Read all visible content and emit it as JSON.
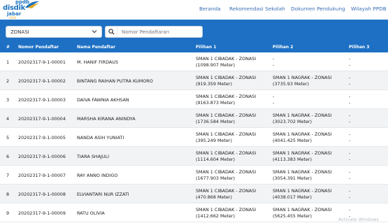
{
  "brand": {
    "line1": "ppdb",
    "line2": "disdik",
    "line3": "jabar",
    "year": "2020",
    "colors": {
      "primary": "#1d70c4",
      "accent": "#e2a820"
    }
  },
  "nav": {
    "items": [
      {
        "label": "Beranda"
      },
      {
        "label": "Rekomendasi Sekolah"
      },
      {
        "label": "Dokumen Pendukung"
      },
      {
        "label": "Wilayah PPDB"
      }
    ]
  },
  "filter": {
    "select_value": "ZONASI",
    "search_placeholder": "Nomor Pendaftaran",
    "select_icon": "chevron-down-icon",
    "search_icon": "search-icon"
  },
  "table": {
    "headers": [
      "#",
      "Nomor Pendaftar",
      "Nama Pendaftar",
      "Pilihan 1",
      "Pilihan 2",
      "Pilihan 3"
    ],
    "rows": [
      {
        "no": "1",
        "nomor": "20202317-9-1-00001",
        "nama": "M. HANIF FIRDAUS",
        "p1": "SMAN 1 CIBADAK - ZONASI",
        "p1d": "(1098.907 Meter)",
        "p2": "-",
        "p2d": "-",
        "p3": "-",
        "p3d": "-"
      },
      {
        "no": "2",
        "nomor": "20202317-9-1-00002",
        "nama": "BINTANG RAIHAN PUTRA KUMORO",
        "p1": "SMAN 1 CIBADAK - ZONASI",
        "p1d": "(919.359 Meter)",
        "p2": "SMAN 1 NAGRAK - ZONASI",
        "p2d": "(3735.93 Meter)",
        "p3": "-",
        "p3d": "-"
      },
      {
        "no": "3",
        "nomor": "20202317-9-1-00003",
        "nama": "DAIVA FAWNIA AKHSAN",
        "p1": "SMAN 1 CIBADAK - ZONASI",
        "p1d": "(9163.873 Meter)",
        "p2": "-",
        "p2d": "-",
        "p3": "-",
        "p3d": "-"
      },
      {
        "no": "4",
        "nomor": "20202317-9-1-00004",
        "nama": "MARSHA KIRANA ANINDYA",
        "p1": "SMAN 1 CIBADAK - ZONASI",
        "p1d": "(1736.584 Meter)",
        "p2": "SMAN 1 NAGRAK - ZONASI",
        "p2d": "(3023.702 Meter)",
        "p3": "-",
        "p3d": "-"
      },
      {
        "no": "5",
        "nomor": "20202317-9-1-00005",
        "nama": "NANDA ASIH YUNIATI",
        "p1": "SMAN 1 CIBADAK - ZONASI",
        "p1d": "(395.249 Meter)",
        "p2": "SMAN 1 NAGRAK - ZONASI",
        "p2d": "(4041.425 Meter)",
        "p3": "-",
        "p3d": "-"
      },
      {
        "no": "6",
        "nomor": "20202317-9-1-00006",
        "nama": "TIARA SHAJULI",
        "p1": "SMAN 1 CIBADAK - ZONASI",
        "p1d": "(1114.604 Meter)",
        "p2": "SMAN 1 NAGRAK - ZONASI",
        "p2d": "(4113.383 Meter)",
        "p3": "-",
        "p3d": "-"
      },
      {
        "no": "7",
        "nomor": "20202317-9-1-00007",
        "nama": "RAY ANNO INDIGO",
        "p1": "SMAN 1 CIBADAK - ZONASI",
        "p1d": "(1677.903 Meter)",
        "p2": "SMAN 1 NAGRAK - ZONASI",
        "p2d": "(3054.391 Meter)",
        "p3": "-",
        "p3d": "-"
      },
      {
        "no": "8",
        "nomor": "20202317-9-1-00008",
        "nama": "ELVIANTARI NUR IZZATI",
        "p1": "SMAN 1 CIBADAK - ZONASI",
        "p1d": "(470.868 Meter)",
        "p2": "SMAN 1 NAGRAK - ZONASI",
        "p2d": "(4038.017 Meter)",
        "p3": "-",
        "p3d": "-"
      },
      {
        "no": "9",
        "nomor": "20202317-9-1-00009",
        "nama": "RATU OLIVIA",
        "p1": "SMAN 1 CIBADAK - ZONASI",
        "p1d": "(1412.662 Meter)",
        "p2": "SMAN 1 NAGRAK - ZONASI",
        "p2d": "(5625.455 Meter)",
        "p3": "-",
        "p3d": "-"
      }
    ]
  },
  "watermark": "Activate Windows"
}
